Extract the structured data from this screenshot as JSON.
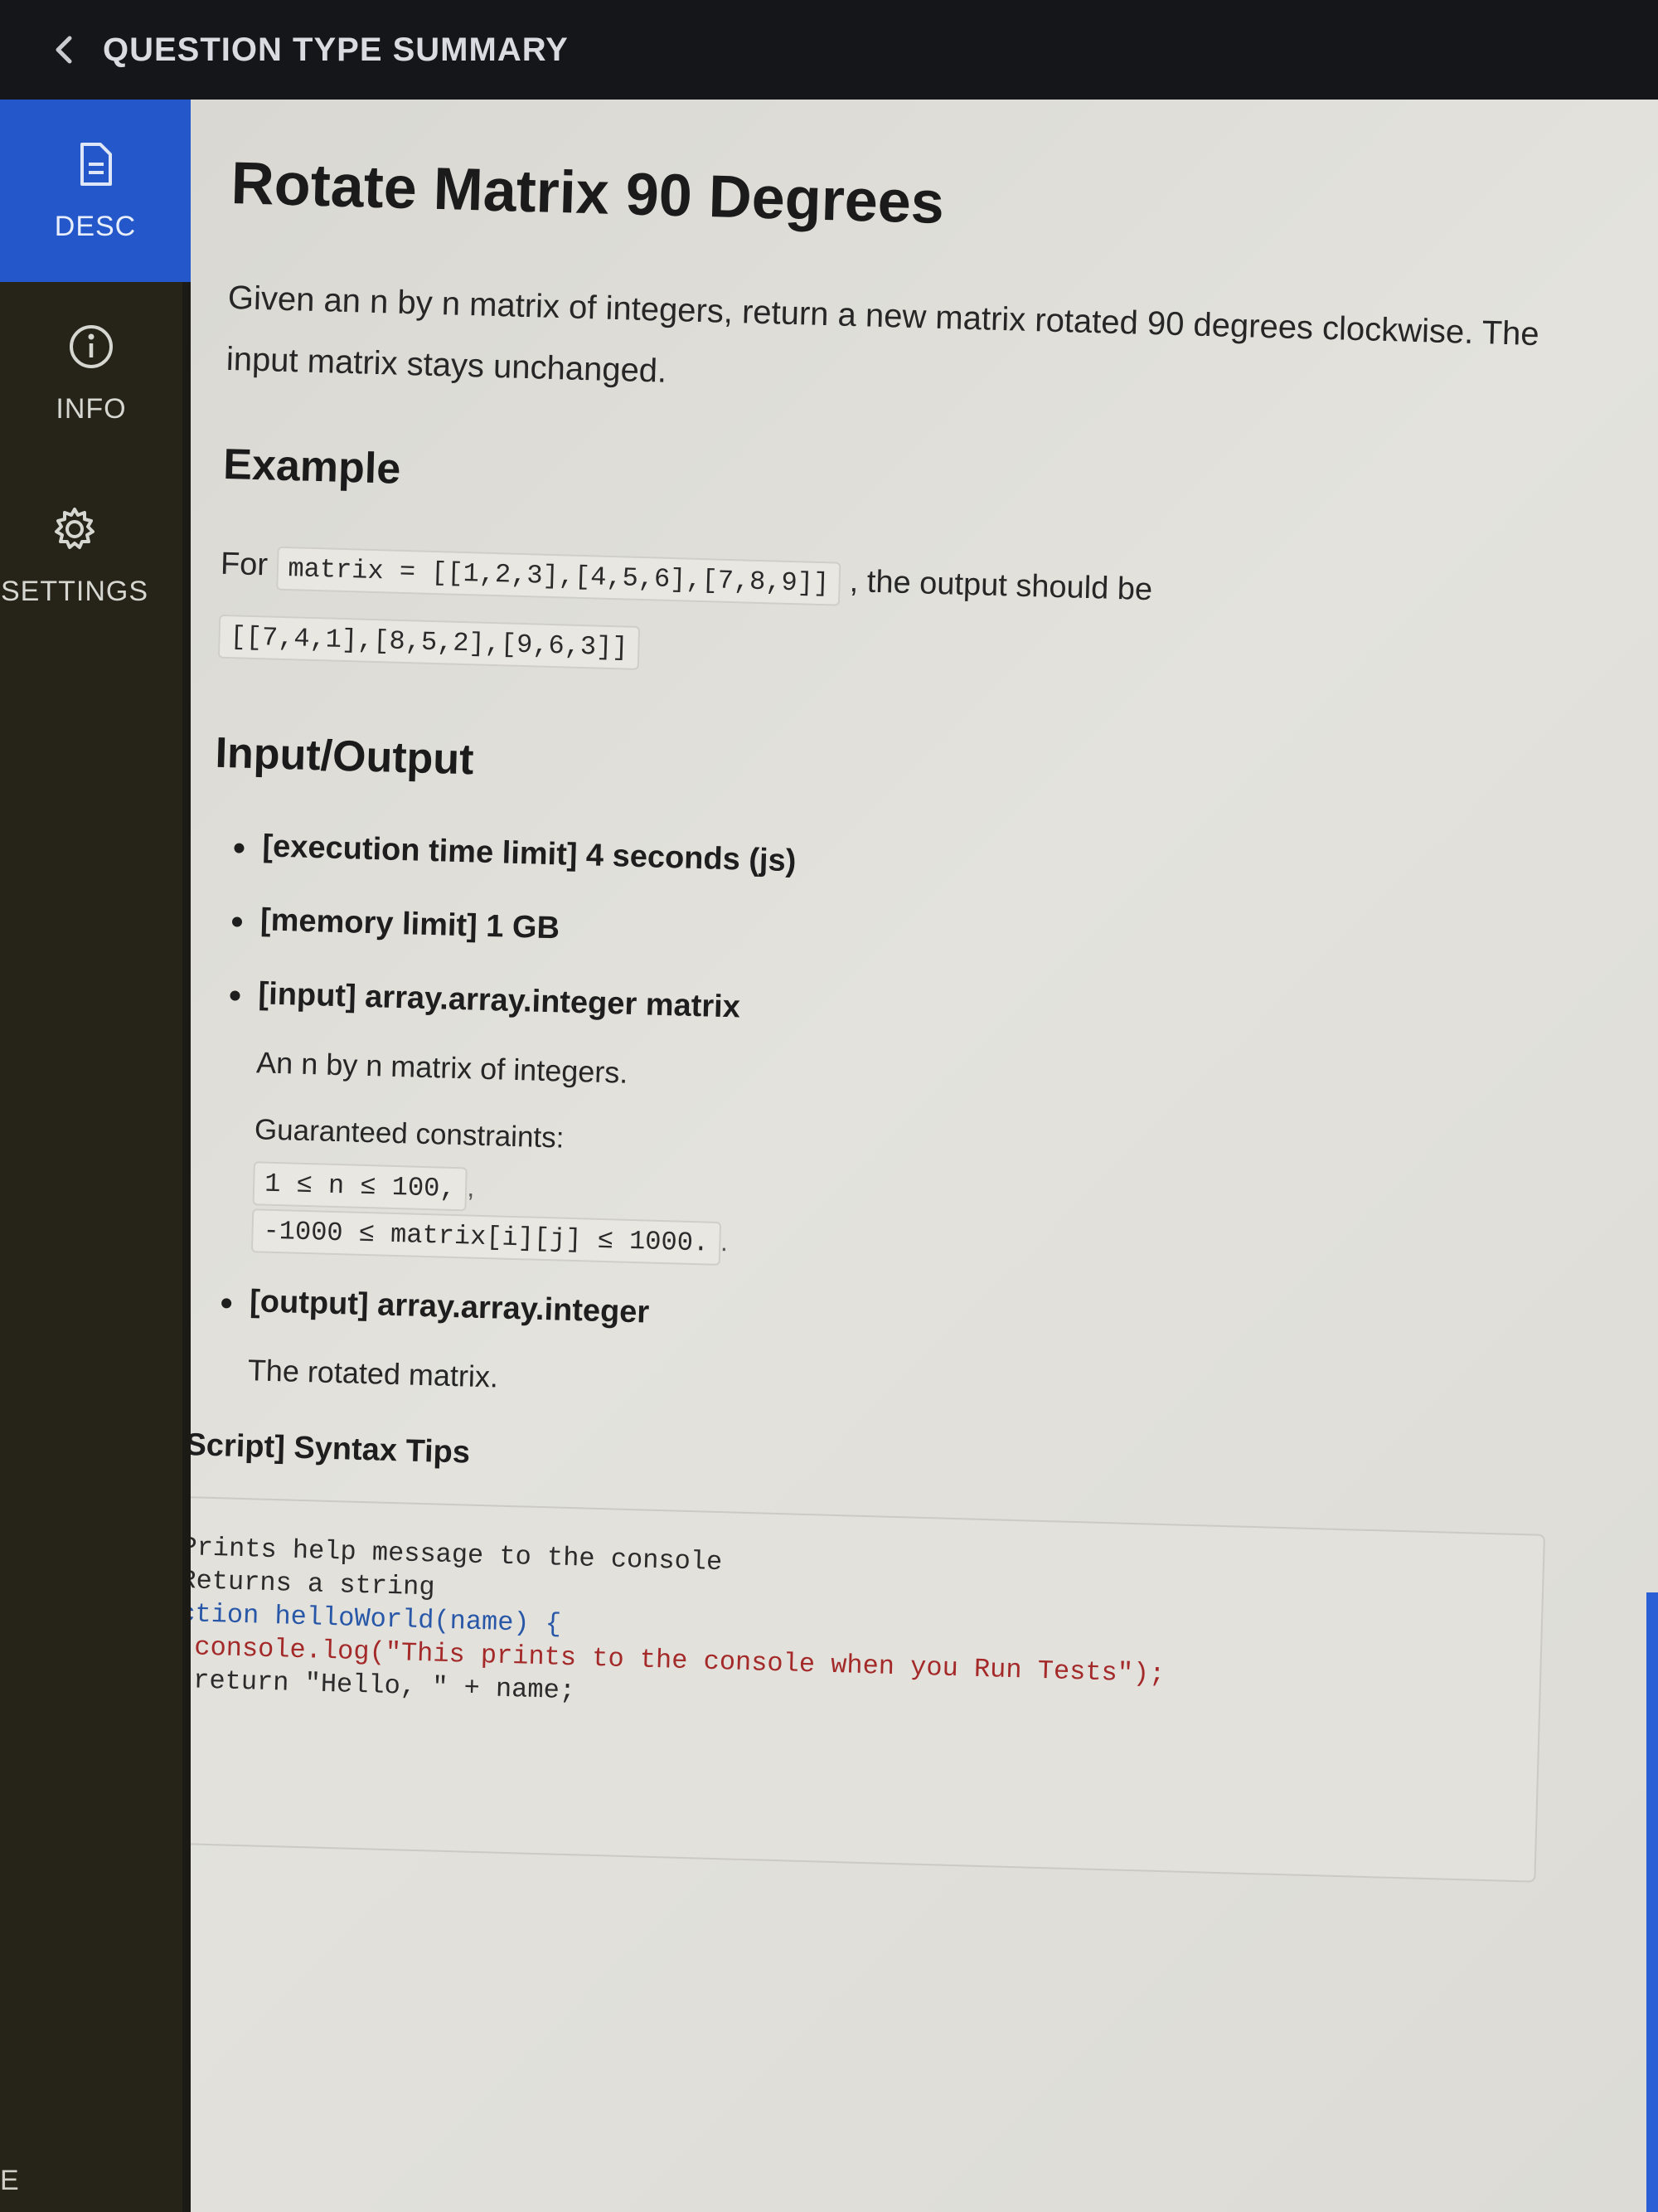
{
  "header": {
    "title": "QUESTION TYPE SUMMARY"
  },
  "sidebar": {
    "items": [
      {
        "label": "DESC",
        "icon": "document-icon",
        "active": true
      },
      {
        "label": "INFO",
        "icon": "info-icon",
        "active": false
      },
      {
        "label": "SETTINGS",
        "icon": "gear-icon",
        "active": false
      }
    ]
  },
  "colors": {
    "accent": "#2457c9",
    "topbar": "#15161a",
    "sidebar": "#262419",
    "content_bg": "#dedcd6"
  },
  "main": {
    "title": "Rotate Matrix 90 Degrees",
    "description": "Given an n by n matrix of integers, return a new matrix rotated 90 degrees clockwise. The input matrix stays unchanged.",
    "example": {
      "heading": "Example",
      "prefix": "For",
      "input_code": "matrix = [[1,2,3],[4,5,6],[7,8,9]]",
      "middle": ", the output should be",
      "output_code": "[[7,4,1],[8,5,2],[9,6,3]]"
    },
    "io": {
      "heading": "Input/Output",
      "items": [
        {
          "head": "[execution time limit] 4 seconds (js)"
        },
        {
          "head": "[memory limit] 1 GB"
        },
        {
          "head": "[input] array.array.integer matrix",
          "desc": "An n by n matrix of integers.",
          "constraints_label": "Guaranteed constraints:",
          "constraints": [
            {
              "code": "1 ≤ n ≤ 100,",
              "trail": ","
            },
            {
              "code": "-1000 ≤ matrix[i][j] ≤ 1000.",
              "trail": "."
            }
          ]
        },
        {
          "head": "[output] array.array.integer",
          "desc": "The rotated matrix."
        }
      ]
    },
    "syntax_tips": {
      "title": "[JavaScript] Syntax Tips",
      "code_lines": [
        "// Prints help message to the console",
        "// Returns a string",
        "function helloWorld(name) {",
        "    console.log(\"This prints to the console when you Run Tests\");",
        "    return \"Hello, \" + name;",
        "}"
      ]
    }
  },
  "footer": {
    "edge_letter": "E"
  }
}
